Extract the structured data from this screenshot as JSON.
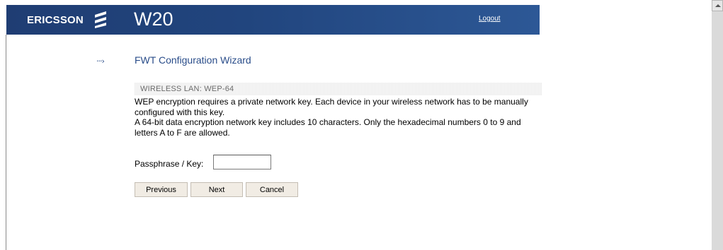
{
  "header": {
    "brand": "ERICSSON",
    "product": "W20",
    "logout_label": "Logout",
    "background_color": "#21457e"
  },
  "wizard": {
    "title": "FWT Configuration Wizard",
    "arrow_icon": "dotted-arrow-icon"
  },
  "section": {
    "title": "WIRELESS LAN: WEP-64"
  },
  "description": {
    "line1": "WEP encryption requires a private network key. Each device in your wireless network has to be manually configured with this key.",
    "line2": "A 64-bit data encryption network key includes 10 characters. Only the hexadecimal numbers 0 to 9 and letters A to F are allowed."
  },
  "form": {
    "passphrase_label": "Passphrase / Key:",
    "passphrase_value": ""
  },
  "buttons": {
    "previous": "Previous",
    "next": "Next",
    "cancel": "Cancel"
  },
  "colors": {
    "accent": "#2a4d8a",
    "button_bg": "#f1ece4"
  }
}
